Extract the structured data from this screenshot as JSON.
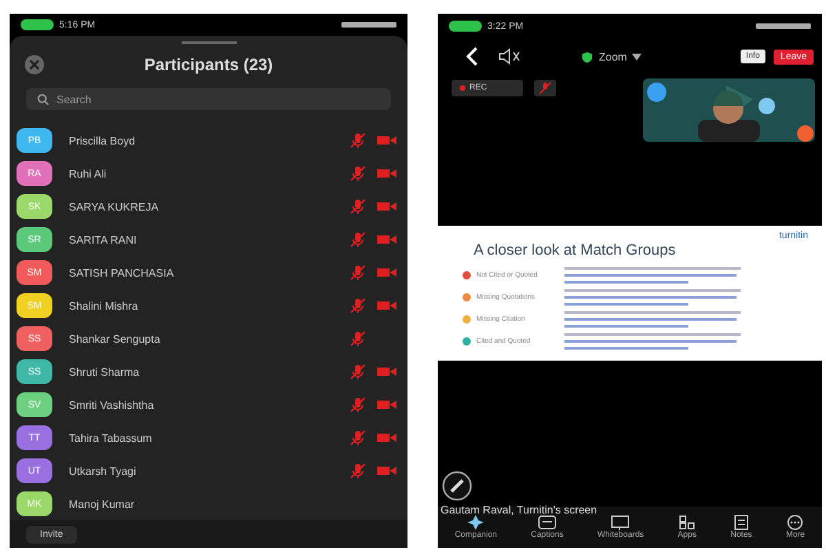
{
  "left_phone": {
    "status_bar": {
      "time": "5:16 PM"
    },
    "title": "Participants (23)",
    "search": {
      "placeholder": "Search"
    },
    "participants": [
      {
        "initials": "PB",
        "name": "Priscilla Boyd",
        "color": "#3fb8f0",
        "muted": true,
        "video_off": true
      },
      {
        "initials": "RA",
        "name": "Ruhi Ali",
        "color": "#e070b8",
        "muted": true,
        "video_off": true
      },
      {
        "initials": "SK",
        "name": "SARYA KUKREJA",
        "color": "#9ad86a",
        "muted": true,
        "video_off": true
      },
      {
        "initials": "SR",
        "name": "SARITA RANI",
        "color": "#5cc87a",
        "muted": true,
        "video_off": true
      },
      {
        "initials": "SM",
        "name": "SATISH PANCHASIA",
        "color": "#f05a5a",
        "muted": true,
        "video_off": true
      },
      {
        "initials": "SM",
        "name": "Shalini Mishra",
        "color": "#f0d020",
        "muted": true,
        "video_off": true
      },
      {
        "initials": "SS",
        "name": "Shankar Sengupta",
        "color": "#f06060",
        "muted": true,
        "video_off": false
      },
      {
        "initials": "SS",
        "name": "Shruti Sharma",
        "color": "#40b8a8",
        "muted": true,
        "video_off": true
      },
      {
        "initials": "SV",
        "name": "Smriti Vashishtha",
        "color": "#6cd080",
        "muted": true,
        "video_off": true
      },
      {
        "initials": "TT",
        "name": "Tahira Tabassum",
        "color": "#9a70e0",
        "muted": true,
        "video_off": true
      },
      {
        "initials": "UT",
        "name": "Utkarsh Tyagi",
        "color": "#9a70e0",
        "muted": true,
        "video_off": true
      },
      {
        "initials": "MK",
        "name": "Manoj Kumar",
        "color": "#9ad86a",
        "muted": false,
        "video_off": false
      }
    ],
    "invite_button": "Invite"
  },
  "right_phone": {
    "status_bar": {
      "time": "3:22 PM"
    },
    "meeting_title": "Zoom",
    "info_button": "Info",
    "leave_button": "Leave",
    "recording_label": "REC",
    "slide": {
      "brand": "turnitin",
      "title": "A closer look at Match Groups",
      "groups": [
        {
          "label": "Not Cited or Quoted",
          "color": "#e05040"
        },
        {
          "label": "Missing Quotations",
          "color": "#f08a40"
        },
        {
          "label": "Missing Citation",
          "color": "#f0b040"
        },
        {
          "label": "Cited and Quoted",
          "color": "#30b0a0"
        }
      ]
    },
    "screen_caption": "Gautam Raval, Turnitin's screen",
    "toolbar": [
      "Companion",
      "Captions",
      "Whiteboards",
      "Apps",
      "Notes",
      "More"
    ]
  }
}
